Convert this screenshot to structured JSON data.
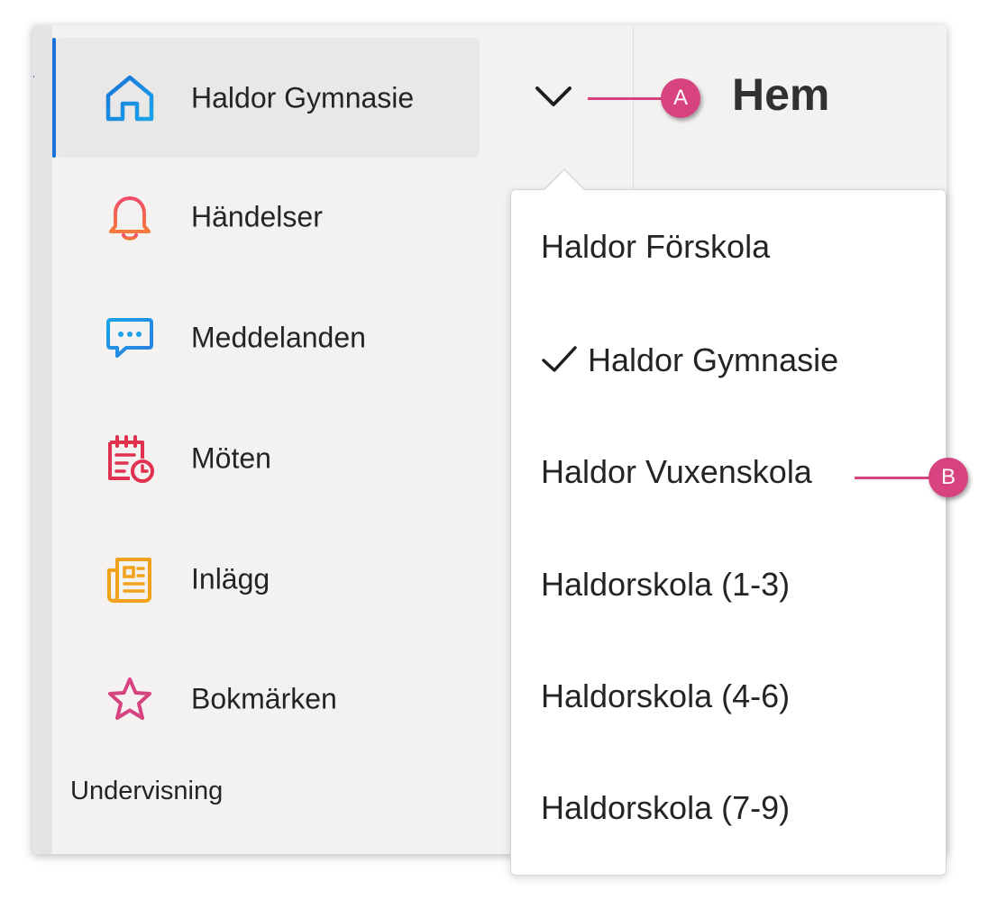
{
  "sidebar": {
    "school_switcher": {
      "label": "Haldor Gymnasie",
      "icon": "home-icon"
    },
    "items": [
      {
        "label": "Händelser",
        "icon": "bell-icon"
      },
      {
        "label": "Meddelanden",
        "icon": "chat-bubble-icon"
      },
      {
        "label": "Möten",
        "icon": "calendar-clock-icon"
      },
      {
        "label": "Inlägg",
        "icon": "newspaper-icon"
      },
      {
        "label": "Bokmärken",
        "icon": "star-icon"
      }
    ],
    "section_heading": "Undervisning"
  },
  "header": {
    "title": "Hem"
  },
  "dropdown": {
    "options": [
      {
        "label": "Haldor Förskola",
        "selected": false
      },
      {
        "label": "Haldor Gymnasie",
        "selected": true
      },
      {
        "label": "Haldor Vuxenskola",
        "selected": false
      },
      {
        "label": "Haldorskola (1-3)",
        "selected": false
      },
      {
        "label": "Haldorskola (4-6)",
        "selected": false
      },
      {
        "label": "Haldorskola (7-9)",
        "selected": false
      }
    ]
  },
  "callouts": {
    "a": "A",
    "b": "B"
  },
  "colors": {
    "active_bar": "#1a73d9",
    "callout": "#d6437f",
    "home_icon": "#1a73d9",
    "bell_icon": "#ef4c4c",
    "chat_icon": "#1aa3e8",
    "calendar_icon": "#e0314f",
    "news_icon": "#f2a21a",
    "star_icon": "#d6437f"
  }
}
